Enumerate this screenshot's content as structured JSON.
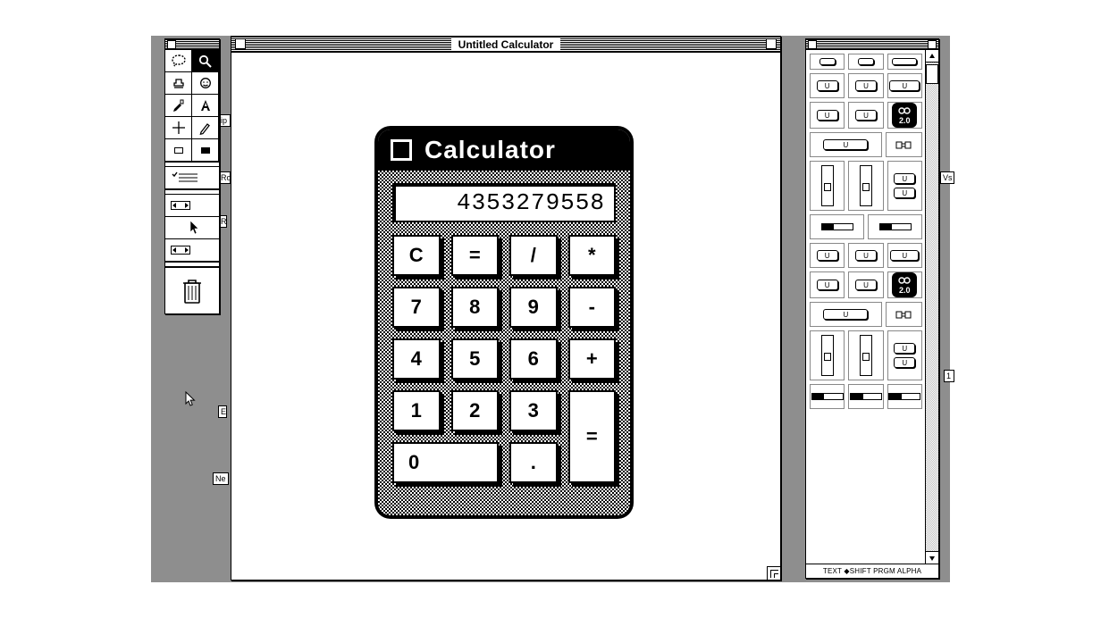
{
  "window": {
    "title": "Untitled Calculator"
  },
  "calculator": {
    "title": "Calculator",
    "display": "4353279558",
    "keys": {
      "c": "C",
      "eq1": "=",
      "div": "/",
      "mul": "*",
      "k7": "7",
      "k8": "8",
      "k9": "9",
      "sub": "-",
      "k4": "4",
      "k5": "5",
      "k6": "6",
      "add": "+",
      "k1": "1",
      "k2": "2",
      "k3": "3",
      "k0": "0",
      "dot": ".",
      "eq2": "="
    }
  },
  "right_palette": {
    "chip_label": "2.0",
    "u": "U",
    "footer": "TEXT  ◆SHIFT  PRGM  ALPHA"
  },
  "peeks": {
    "ne": "Ne",
    "ip": "ip",
    "ro": "Ro",
    "r": "R",
    "e": "E",
    "vs": "Vs",
    "num": "1"
  }
}
